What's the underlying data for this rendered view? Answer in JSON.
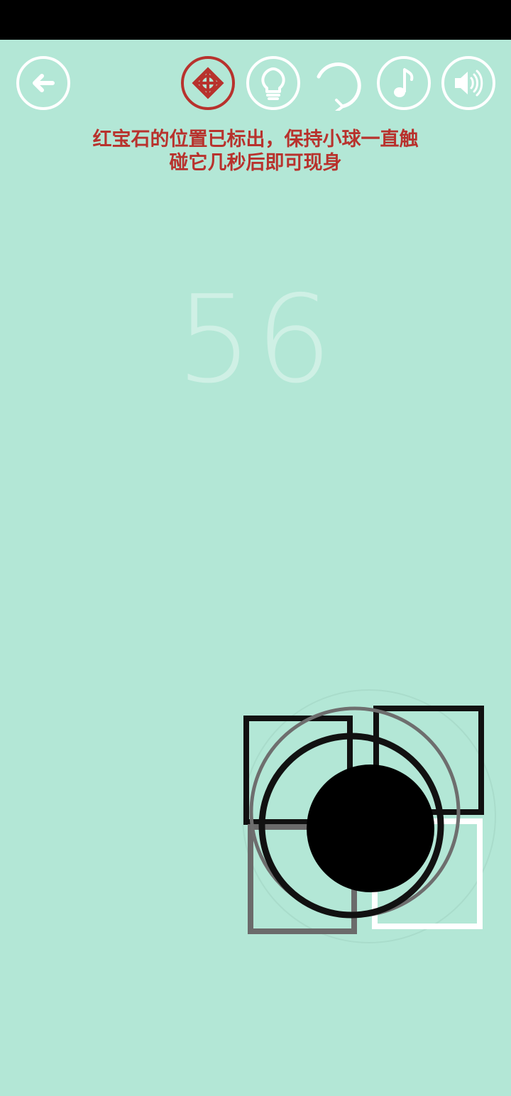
{
  "toolbar": {
    "back_icon": "arrow-left-icon",
    "gem_locator_icon": "gem-target-icon",
    "hint_icon": "lightbulb-icon",
    "restart_icon": "restart-icon",
    "music_icon": "music-note-icon",
    "sound_icon": "speaker-icon",
    "accent_color": "#b8322d",
    "icon_color": "#ffffff"
  },
  "hint": {
    "line1": "红宝石的位置已标出，保持小球一直触",
    "line2": "碰它几秒后即可现身"
  },
  "score": "56",
  "colors": {
    "background": "#b3e7d6",
    "status_bar": "#000000",
    "ball": "#000000"
  }
}
